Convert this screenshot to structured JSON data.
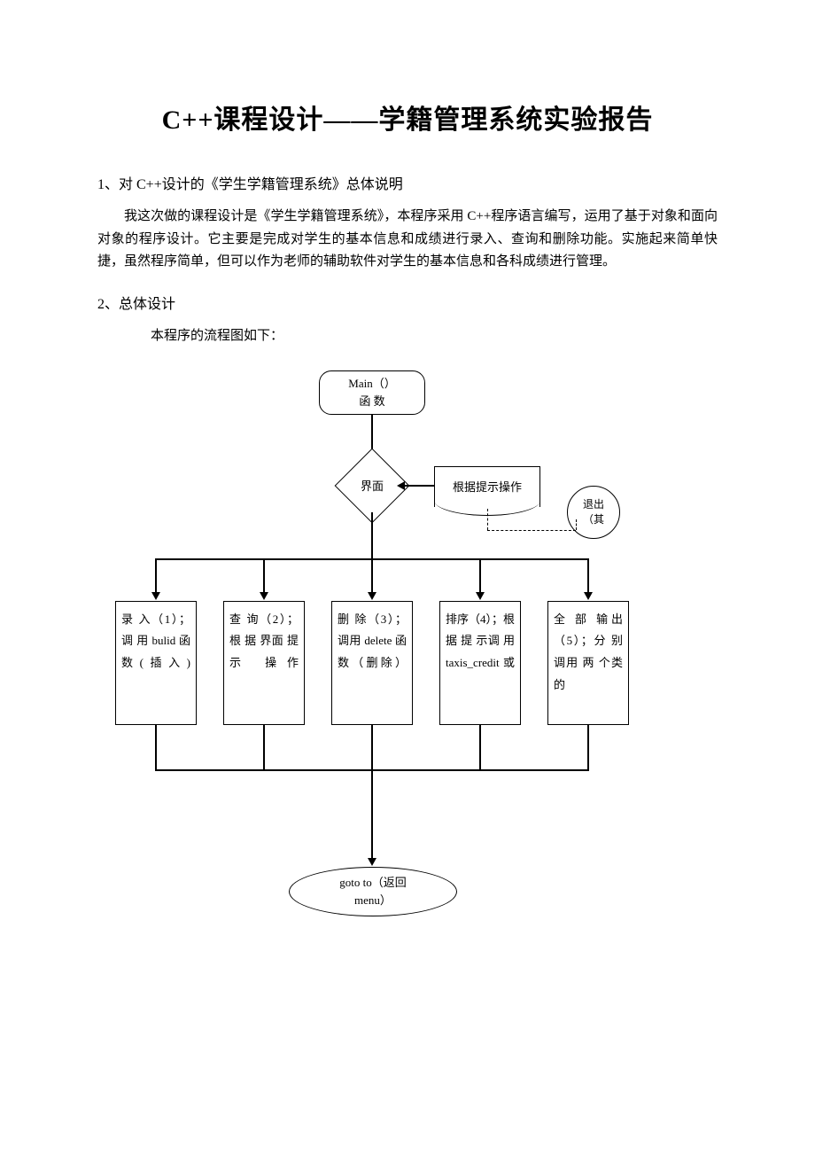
{
  "title": "C++课程设计——学籍管理系统实验报告",
  "section1": {
    "heading": "1、对 C++设计的《学生学籍管理系统》总体说明",
    "body": "我这次做的课程设计是《学生学籍管理系统》，本程序采用 C++程序语言编写，运用了基于对象和面向对象的程序设计。它主要是完成对学生的基本信息和成绩进行录入、查询和删除功能。实施起来简单快捷，虽然程序简单，但可以作为老师的辅助软件对学生的基本信息和各科成绩进行管理。"
  },
  "section2": {
    "heading": "2、总体设计",
    "flow_intro": "本程序的流程图如下：",
    "nodes": {
      "main_line1": "Main（）",
      "main_line2": "函    数",
      "decision": "界面",
      "prompt": "根据提示操作",
      "exit_line1": "退出",
      "exit_line2": "（其",
      "proc1": "录 入（1）；调 用 bulid 函数(插入)",
      "proc2": "查 询（2）；根 据 界面 提 示 操作",
      "proc3": "删 除（3）；调用 delete 函数（删除）",
      "proc4": "排序（4）；根 据 提 示调 用 taxis_credit 或",
      "proc5": "全 部 输出（5）；分 别 调用 两 个类 的",
      "goto_line1": "goto to（返回",
      "goto_line2": "menu）"
    }
  },
  "chart_data": {
    "type": "flowchart",
    "nodes": [
      {
        "id": "main",
        "type": "terminator",
        "label": "Main（）函数"
      },
      {
        "id": "ui",
        "type": "decision",
        "label": "界面"
      },
      {
        "id": "prompt",
        "type": "document",
        "label": "根据提示操作"
      },
      {
        "id": "exit",
        "type": "terminator",
        "label": "退出（其"
      },
      {
        "id": "p1",
        "type": "process",
        "label": "录入（1）；调用 bulid 函数(插入)"
      },
      {
        "id": "p2",
        "type": "process",
        "label": "查询（2）；根据界面提示操作"
      },
      {
        "id": "p3",
        "type": "process",
        "label": "删除（3）；调用 delete 函数（删除）"
      },
      {
        "id": "p4",
        "type": "process",
        "label": "排序（4）；根据提示调用 taxis_credit 或"
      },
      {
        "id": "p5",
        "type": "process",
        "label": "全部输出（5）；分别调用两个类的"
      },
      {
        "id": "goto",
        "type": "terminator",
        "label": "goto to（返回 menu）"
      }
    ],
    "edges": [
      {
        "from": "main",
        "to": "ui"
      },
      {
        "from": "prompt",
        "to": "ui"
      },
      {
        "from": "ui",
        "to": "exit",
        "style": "dashed"
      },
      {
        "from": "ui",
        "to": "p1"
      },
      {
        "from": "ui",
        "to": "p2"
      },
      {
        "from": "ui",
        "to": "p3"
      },
      {
        "from": "ui",
        "to": "p4"
      },
      {
        "from": "ui",
        "to": "p5"
      },
      {
        "from": "p1",
        "to": "goto"
      },
      {
        "from": "p2",
        "to": "goto"
      },
      {
        "from": "p3",
        "to": "goto"
      },
      {
        "from": "p4",
        "to": "goto"
      },
      {
        "from": "p5",
        "to": "goto"
      }
    ]
  }
}
